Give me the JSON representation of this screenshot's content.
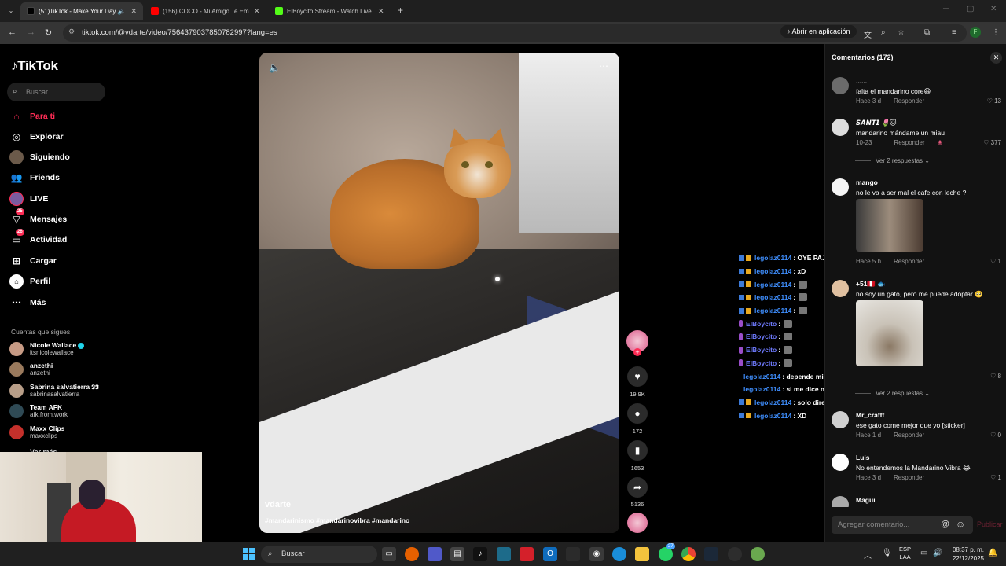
{
  "browser": {
    "tabs": [
      {
        "title": "(51)TikTok - Make Your Day",
        "active": true,
        "favicon_color": "#111111"
      },
      {
        "title": "(156) COCO - Mi Amigo Te Emp",
        "active": false,
        "favicon_color": "#ff0000"
      },
      {
        "title": "ElBoycito Stream - Watch Live o",
        "active": false,
        "favicon_color": "#53fc18"
      }
    ],
    "url": "tiktok.com/@vdarte/video/7564379037850782997?lang=es",
    "open_in_app": "Abrir en aplicación",
    "profile_initial": "F"
  },
  "sidebar": {
    "logo": "TikTok",
    "search_placeholder": "Buscar",
    "nav": [
      {
        "label": "Para ti",
        "icon": "home-icon",
        "active": true
      },
      {
        "label": "Explorar",
        "icon": "compass-icon"
      },
      {
        "label": "Siguiendo",
        "icon": "following-icon"
      },
      {
        "label": "Friends",
        "icon": "friends-icon"
      },
      {
        "label": "LIVE",
        "icon": "live-icon"
      },
      {
        "label": "Mensajes",
        "icon": "messages-icon",
        "badge": "25"
      },
      {
        "label": "Actividad",
        "icon": "activity-icon",
        "badge": "26"
      },
      {
        "label": "Cargar",
        "icon": "upload-icon"
      },
      {
        "label": "Perfil",
        "icon": "profile-icon"
      },
      {
        "label": "Más",
        "icon": "more-icon"
      }
    ],
    "following_title": "Cuentas que sigues",
    "following": [
      {
        "name": "Nicole Wallace",
        "handle": "itsnicolewallace",
        "verified": true,
        "color": "#c79b85"
      },
      {
        "name": "anzethi",
        "handle": "anzethi",
        "color": "#9a7a5d"
      },
      {
        "name": "Sabrina salvatierra 𝟑𝟑",
        "handle": "sabrinasalvatierra",
        "color": "#b89e88"
      },
      {
        "name": "Team AFK",
        "handle": "afk.from.work",
        "color": "#2f4a55"
      },
      {
        "name": "Maxx Clips",
        "handle": "maxxclips",
        "color": "#c4302b"
      }
    ],
    "more_label": "Ver más"
  },
  "video": {
    "author": "vdarte",
    "hashtags": "#mandarinismo #mandarinovibra #mandarino",
    "likes": "19.9K",
    "comments": "172",
    "saves": "1653",
    "shares": "5136"
  },
  "stream_chat": [
    {
      "user": "legolaz0114",
      "msg": ": OYE PAJIN",
      "type": "sub"
    },
    {
      "user": "legolaz0114",
      "msg": ": xD",
      "type": "sub"
    },
    {
      "user": "legolaz0114",
      "msg": ":",
      "type": "sub",
      "emote": true
    },
    {
      "user": "legolaz0114",
      "msg": ":",
      "type": "sub",
      "emote": true
    },
    {
      "user": "legolaz0114",
      "msg": ":",
      "type": "sub",
      "emote": true
    },
    {
      "user": "ElBoycito",
      "msg": ":",
      "type": "host",
      "emote": true
    },
    {
      "user": "ElBoycito",
      "msg": ":",
      "type": "host",
      "emote": true
    },
    {
      "user": "ElBoycito",
      "msg": ":",
      "type": "host",
      "emote": true
    },
    {
      "user": "ElBoycito",
      "msg": ":",
      "type": "host",
      "emote": true
    },
    {
      "user": "legolaz0114",
      "msg": ": depende mi relacion de este texto",
      "type": "sub"
    },
    {
      "user": "legolaz0114",
      "msg": ": si me dice no, ya pue gg",
      "type": "sub"
    },
    {
      "user": "legolaz0114",
      "msg": ": solo dire soga",
      "type": "sub"
    },
    {
      "user": "legolaz0114",
      "msg": ": XD",
      "type": "sub"
    }
  ],
  "comments": {
    "title": "Comentarios (172)",
    "reply_label": "Responder",
    "items": [
      {
        "name": "......",
        "text": "falta el mandarino core😆",
        "time": "Hace 3 d",
        "likes": "13",
        "avatar": "#6b6b6b"
      },
      {
        "name": "𝙎𝘼𝙉𝙏𝙄 🌷🐱",
        "text": "mandarino mándame un miau",
        "time": "10-23",
        "likes": "377",
        "avatar": "#dcdcdc",
        "replies": "Ver 2 respuestas"
      },
      {
        "name": "mango",
        "text": "no le va a ser mal el cafe con leche ?",
        "time": "Hace 5 h",
        "likes": "1",
        "avatar": "#f5f5f5"
      },
      {
        "name": "+51🇵🇪 🐟",
        "text": "no soy un gato, pero me puede adoptar 🥺",
        "time": "",
        "likes": "8",
        "avatar": "#e0c0a0",
        "replies": "Ver 2 respuestas"
      },
      {
        "name": "Mr_craftt",
        "text": "ese gato come mejor que yo [sticker]",
        "time": "Hace 1 d",
        "likes": "0",
        "avatar": "#d0d0d0"
      },
      {
        "name": "Luis",
        "text": "No entendemos la Mandarino Vibra 😂",
        "time": "Hace 3 d",
        "likes": "1",
        "avatar": "#ffffff"
      },
      {
        "name": "Magui",
        "text": "",
        "time": "",
        "likes": "",
        "avatar": "#aaaaaa"
      }
    ],
    "input_placeholder": "Agregar comentario...",
    "post_label": "Publicar"
  },
  "taskbar": {
    "search_label": "Buscar",
    "lang": "ESP",
    "lang_sub": "LAA",
    "time": "08:37 p. m.",
    "date": "22/12/2025",
    "whatsapp_badge": "27"
  }
}
